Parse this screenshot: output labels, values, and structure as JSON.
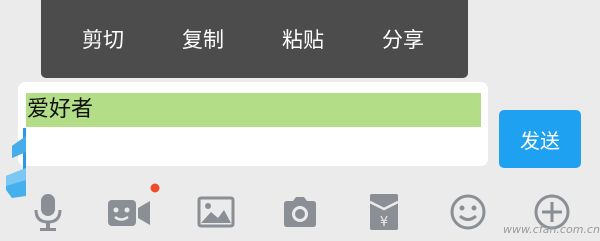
{
  "context_menu": {
    "items": [
      {
        "label": "剪切"
      },
      {
        "label": "复制"
      },
      {
        "label": "粘贴"
      },
      {
        "label": "分享"
      }
    ]
  },
  "input": {
    "value": "爱好者"
  },
  "send_button": {
    "label": "发送"
  },
  "toolbar": {
    "icons": [
      "microphone-icon",
      "video-icon",
      "image-icon",
      "camera-icon",
      "red-packet-icon",
      "emoji-icon",
      "plus-icon"
    ],
    "video_badge_color": "#f04b2b"
  },
  "colors": {
    "accent": "#1ea1f0",
    "selection": "#b3dd86",
    "menu_bg": "#4c4c4c",
    "icon": "#8a8f96"
  },
  "watermark": {
    "text": "www.cfan.com.cn"
  }
}
